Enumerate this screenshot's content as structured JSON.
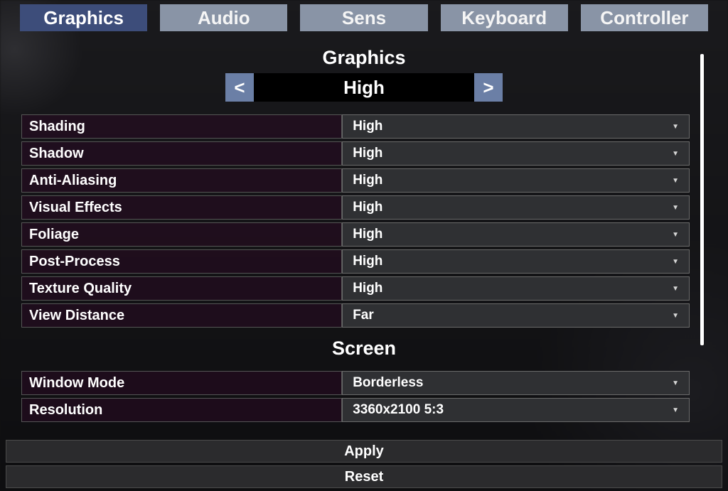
{
  "tabs": [
    {
      "id": "graphics",
      "label": "Graphics",
      "active": true
    },
    {
      "id": "audio",
      "label": "Audio",
      "active": false
    },
    {
      "id": "sens",
      "label": "Sens",
      "active": false
    },
    {
      "id": "keyboard",
      "label": "Keyboard",
      "active": false
    },
    {
      "id": "controller",
      "label": "Controller",
      "active": false
    }
  ],
  "sections": {
    "graphics": {
      "title": "Graphics",
      "preset": {
        "prev_glyph": "<",
        "value": "High",
        "next_glyph": ">"
      },
      "rows": [
        {
          "label": "Shading",
          "value": "High"
        },
        {
          "label": "Shadow",
          "value": "High"
        },
        {
          "label": "Anti-Aliasing",
          "value": "High"
        },
        {
          "label": "Visual Effects",
          "value": "High"
        },
        {
          "label": "Foliage",
          "value": "High"
        },
        {
          "label": "Post-Process",
          "value": "High"
        },
        {
          "label": "Texture Quality",
          "value": "High"
        },
        {
          "label": "View Distance",
          "value": "Far"
        }
      ]
    },
    "screen": {
      "title": "Screen",
      "rows": [
        {
          "label": "Window Mode",
          "value": "Borderless"
        },
        {
          "label": "Resolution",
          "value": "3360x2100   5:3"
        }
      ]
    }
  },
  "actions": {
    "apply": "Apply",
    "reset": "Reset"
  }
}
